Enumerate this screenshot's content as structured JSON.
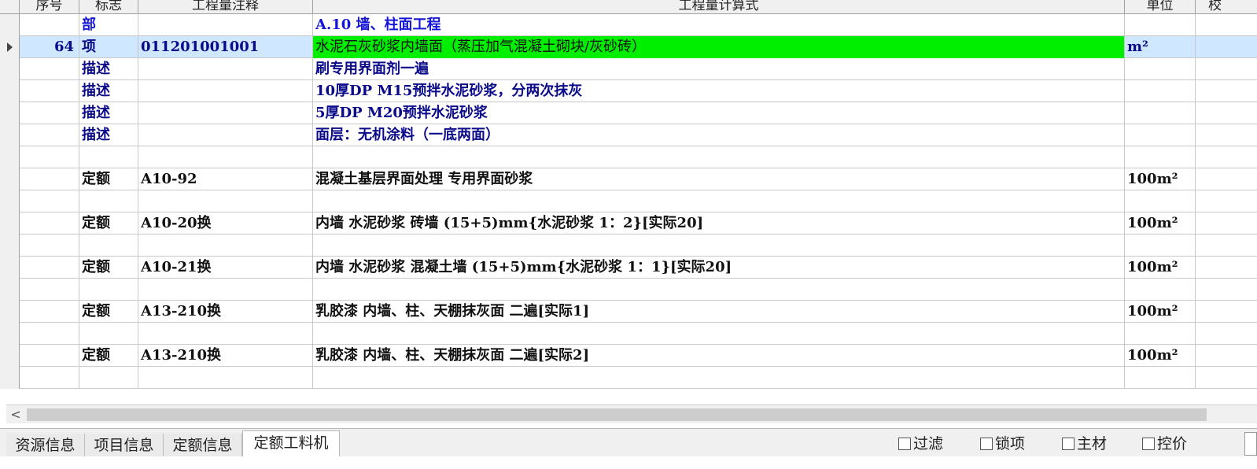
{
  "columns": {
    "seq": "序号",
    "flag": "标志",
    "note": "工程量注释",
    "formula": "工程量计算式",
    "unit": "单位",
    "extra": "校"
  },
  "rows": [
    {
      "seq": "",
      "flag": "部",
      "note": "",
      "formula": "A.10 墙、柱面工程",
      "unit": "",
      "level": "part"
    },
    {
      "seq": "64",
      "flag": "项",
      "note": "011201001001",
      "formula": "水泥石灰砂浆内墙面（蒸压加气混凝土砌块/灰砂砖）",
      "unit": "m²",
      "level": "item",
      "selected": true
    },
    {
      "seq": "",
      "flag": "描述",
      "note": "",
      "formula": "刷专用界面剂一遍",
      "unit": "",
      "level": "desc"
    },
    {
      "seq": "",
      "flag": "描述",
      "note": "",
      "formula": "10厚DP M15预拌水泥砂浆，分两次抹灰",
      "unit": "",
      "level": "desc"
    },
    {
      "seq": "",
      "flag": "描述",
      "note": "",
      "formula": "5厚DP M20预拌水泥砂浆",
      "unit": "",
      "level": "desc"
    },
    {
      "seq": "",
      "flag": "描述",
      "note": "",
      "formula": "面层：无机涂料（一底两面）",
      "unit": "",
      "level": "desc"
    },
    {
      "seq": "",
      "flag": "",
      "note": "",
      "formula": "",
      "unit": "",
      "level": "blank"
    },
    {
      "seq": "",
      "flag": "定额",
      "note": "A10-92",
      "formula": "混凝土基层界面处理 专用界面砂浆",
      "unit": "100m²",
      "level": "quota"
    },
    {
      "seq": "",
      "flag": "",
      "note": "",
      "formula": "",
      "unit": "",
      "level": "blank"
    },
    {
      "seq": "",
      "flag": "定额",
      "note": "A10-20换",
      "formula": "内墙 水泥砂浆 砖墙 (15+5)mm{水泥砂浆 1：2}[实际20]",
      "unit": "100m²",
      "level": "quota"
    },
    {
      "seq": "",
      "flag": "",
      "note": "",
      "formula": "",
      "unit": "",
      "level": "blank"
    },
    {
      "seq": "",
      "flag": "定额",
      "note": "A10-21换",
      "formula": "内墙 水泥砂浆 混凝土墙 (15+5)mm{水泥砂浆 1：1}[实际20]",
      "unit": "100m²",
      "level": "quota"
    },
    {
      "seq": "",
      "flag": "",
      "note": "",
      "formula": "",
      "unit": "",
      "level": "blank"
    },
    {
      "seq": "",
      "flag": "定额",
      "note": "A13-210换",
      "formula": "乳胶漆 内墙、柱、天棚抹灰面 二遍[实际1]",
      "unit": "100m²",
      "level": "quota"
    },
    {
      "seq": "",
      "flag": "",
      "note": "",
      "formula": "",
      "unit": "",
      "level": "blank"
    },
    {
      "seq": "",
      "flag": "定额",
      "note": "A13-210换",
      "formula": "乳胶漆 内墙、柱、天棚抹灰面 二遍[实际2]",
      "unit": "100m²",
      "level": "quota"
    },
    {
      "seq": "",
      "flag": "",
      "note": "",
      "formula": "",
      "unit": "",
      "level": "blank"
    }
  ],
  "scrollbar": {
    "left_arrow": "<"
  },
  "tabs": [
    "资源信息",
    "项目信息",
    "定额信息",
    "定额工料机"
  ],
  "active_tab": "定额工料机",
  "checkboxes": [
    "过滤",
    "锁项",
    "主材",
    "控价"
  ],
  "colors": {
    "selection": "#cfe8ff",
    "highlight": "#00ee00",
    "part_text": "#1515d8"
  }
}
